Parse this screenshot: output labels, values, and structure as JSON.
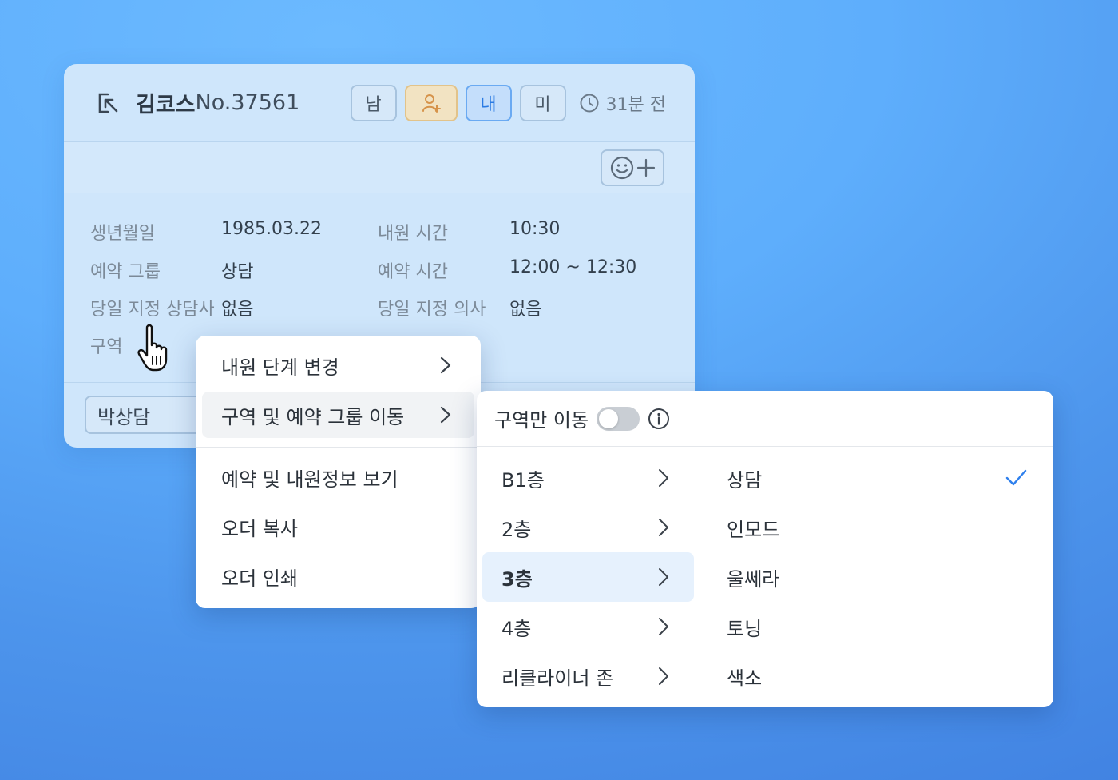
{
  "card": {
    "name": "김코스",
    "number": "No.37561",
    "badges": {
      "gender": "남",
      "mine": "내",
      "status": "미"
    },
    "time_ago": "31분 전",
    "info": {
      "birth_label": "생년월일",
      "birth_value": "1985.03.22",
      "visit_time_label": "내원 시간",
      "visit_time_value": "10:30",
      "group_label": "예약 그룹",
      "group_value": "상담",
      "reservation_time_label": "예약 시간",
      "reservation_time_value": "12:00 ~ 12:30",
      "counselor_label": "당일 지정 상담사",
      "counselor_value": "없음",
      "doctor_label": "당일 지정 의사",
      "doctor_value": "없음",
      "zone_label": "구역"
    },
    "footer_chip": "박상담"
  },
  "context_menu": {
    "items": [
      {
        "label": "내원 단계 변경",
        "submenu": true
      },
      {
        "label": "구역 및 예약 그룹 이동",
        "submenu": true
      },
      {
        "label": "예약 및 내원정보 보기",
        "submenu": false
      },
      {
        "label": "오더 복사",
        "submenu": false
      },
      {
        "label": "오더 인쇄",
        "submenu": false
      }
    ]
  },
  "submenu": {
    "toggle_label": "구역만 이동",
    "toggle_on": false,
    "floors": [
      "B1층",
      "2층",
      "3층",
      "4층",
      "리클라이너 존"
    ],
    "active_floor": "3층",
    "groups": [
      "상담",
      "인모드",
      "울쎄라",
      "토닝",
      "색소"
    ],
    "selected_group": "상담"
  },
  "colors": {
    "accent": "#2b7be3",
    "check": "#2f80ed",
    "card_bg": "#cfe6fb"
  }
}
